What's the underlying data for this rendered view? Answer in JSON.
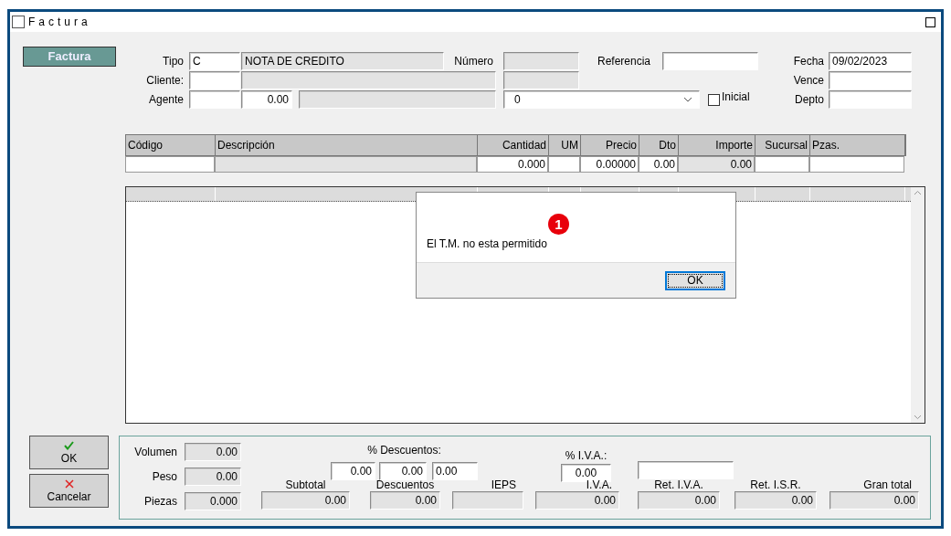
{
  "window": {
    "title": "Factura"
  },
  "header_button": "Factura",
  "header": {
    "tipo": {
      "label": "Tipo",
      "code": "C",
      "name": "NOTA DE CREDITO"
    },
    "numero": {
      "label": "Número"
    },
    "referencia": {
      "label": "Referencia"
    },
    "fecha": {
      "label": "Fecha",
      "value": "09/02/2023"
    },
    "cliente": {
      "label": "Cliente:"
    },
    "vence": {
      "label": "Vence"
    },
    "agente": {
      "label": "Agente",
      "amount": "0.00"
    },
    "combo": {
      "value": "0"
    },
    "inicial": {
      "label": "Inicial",
      "checked": false
    },
    "depto": {
      "label": "Depto"
    }
  },
  "grid": {
    "columns": [
      {
        "label": "Código",
        "disabled": false
      },
      {
        "label": "Descripción",
        "disabled": true
      },
      {
        "label": "Cantidad",
        "disabled": false,
        "entry": "0.000"
      },
      {
        "label": "UM",
        "disabled": false
      },
      {
        "label": "Precio",
        "disabled": false,
        "entry": "0.00000"
      },
      {
        "label": "Dto",
        "disabled": false,
        "entry": "0.00"
      },
      {
        "label": "Importe",
        "disabled": true,
        "entry": "0.00"
      },
      {
        "label": "Sucursal",
        "disabled": false
      },
      {
        "label": "Pzas.",
        "disabled": false
      }
    ]
  },
  "dialog": {
    "message": "El T.M. no esta permitido",
    "button": "OK",
    "badge": "1"
  },
  "buttons": [
    {
      "label": "OK",
      "kind": "ok"
    },
    {
      "label": "Cancelar",
      "kind": "cancel"
    }
  ],
  "summary": {
    "measures": [
      {
        "label": "Volumen",
        "value": "0.00"
      },
      {
        "label": "Peso",
        "value": "0.00"
      },
      {
        "label": "Piezas",
        "value": "0.000"
      }
    ],
    "descuentos": {
      "label": "% Descuentos:",
      "values": [
        "0.00",
        "0.00",
        "0.00"
      ]
    },
    "iva": {
      "label": "% I.V.A.:",
      "value": "0.00"
    },
    "totals": [
      {
        "label": "Subtotal",
        "value": "0.00"
      },
      {
        "label": "Descuentos",
        "value": "0.00"
      },
      {
        "label": "IEPS"
      },
      {
        "label": "I.V.A.",
        "value": "0.00"
      },
      {
        "label": "Ret. I.V.A.",
        "value": "0.00"
      },
      {
        "label": "Ret. I.S.R.",
        "value": "0.00"
      },
      {
        "label": "Gran total",
        "value": "0.00"
      }
    ]
  }
}
